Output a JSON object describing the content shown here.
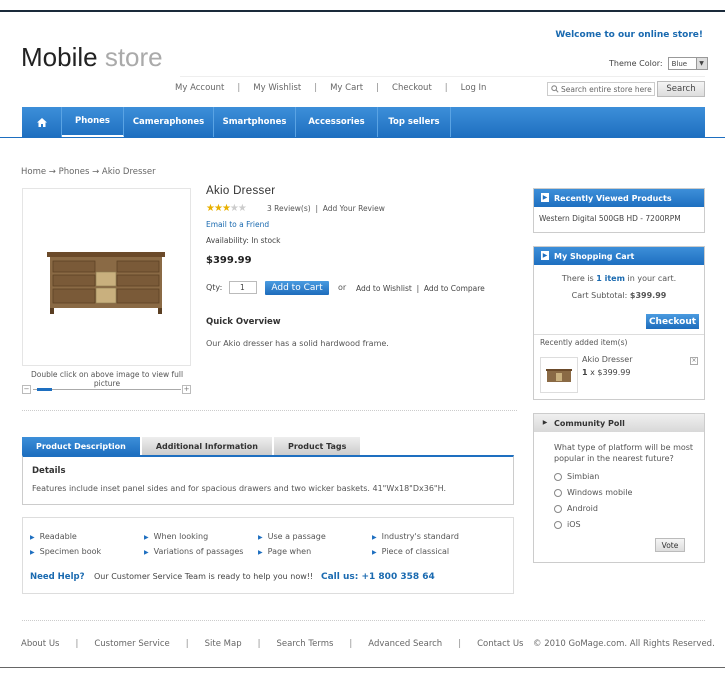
{
  "header": {
    "logo_main": "Mobile",
    "logo_sub": "store",
    "welcome": "Welcome to our online store!",
    "theme_label": "Theme Color:",
    "theme_value": "Blue",
    "links": [
      "My Account",
      "My Wishlist",
      "My Cart",
      "Checkout",
      "Log In"
    ],
    "search_placeholder": "Search entire store here",
    "search_button": "Search"
  },
  "nav": {
    "items": [
      "Phones",
      "Cameraphones",
      "Smartphones",
      "Accessories",
      "Top sellers"
    ],
    "active": "Phones"
  },
  "breadcrumb": "Home → Phones → Akio Dresser",
  "product": {
    "name": "Akio Dresser",
    "rating_stars": 3,
    "rating_max": 5,
    "reviews": "3 Review(s)",
    "add_review": "Add Your Review",
    "email_friend": "Email to a Friend",
    "availability": "Availability: In stock",
    "price": "$399.99",
    "qty_label": "Qty:",
    "qty_value": "1",
    "add_to_cart": "Add to Cart",
    "or": "or",
    "add_wishlist": "Add to Wishlist",
    "add_compare": "Add to Compare",
    "quick_overview_title": "Quick Overview",
    "quick_overview_text": "Our Akio dresser has a solid hardwood frame.",
    "image_hint": "Double click on above image to view full picture",
    "zoom_level": 0.1
  },
  "tabs": {
    "items": [
      "Product Description",
      "Additional Information",
      "Product Tags"
    ],
    "active": "Product Description",
    "details_title": "Details",
    "details_text": "Features include inset panel sides and for spacious drawers and two wicker baskets. 41\"Wx18\"Dx36\"H."
  },
  "links_box": {
    "col1": [
      "Readable",
      "Specimen book"
    ],
    "col2": [
      "When looking",
      "Variations of passages"
    ],
    "col3": [
      "Use a passage",
      "Page when"
    ],
    "col4": [
      "Industry's standard",
      "Piece of classical"
    ],
    "help_label": "Need Help?",
    "help_text": "Our Customer Service Team is ready to help you now!!",
    "call": "Call us: +1 800 358 64"
  },
  "sidebar": {
    "recent_title": "Recently Viewed Products",
    "recent_item": "Western Digital 500GB HD - 7200RPM",
    "cart_title": "My Shopping Cart",
    "cart_there_is": "There is",
    "cart_item_count": "1 item",
    "cart_in_cart": "in your cart.",
    "cart_subtotal_label": "Cart Subtotal:",
    "cart_subtotal": "$399.99",
    "checkout": "Checkout",
    "recently_added": "Recently added item(s)",
    "cart_item_name": "Akio Dresser",
    "cart_item_qty": "1",
    "cart_item_price": "x $399.99",
    "poll_title": "Community Poll",
    "poll_question": "What type of platform will be most popular in the nearest future?",
    "poll_options": [
      "Simbian",
      "Windows mobile",
      "Android",
      "iOS"
    ],
    "vote": "Vote"
  },
  "footer": {
    "links": [
      "About Us",
      "Customer Service",
      "Site Map",
      "Search Terms",
      "Advanced Search",
      "Contact Us"
    ],
    "copyright": "© 2010 GoMage.com. All Rights Reserved."
  }
}
